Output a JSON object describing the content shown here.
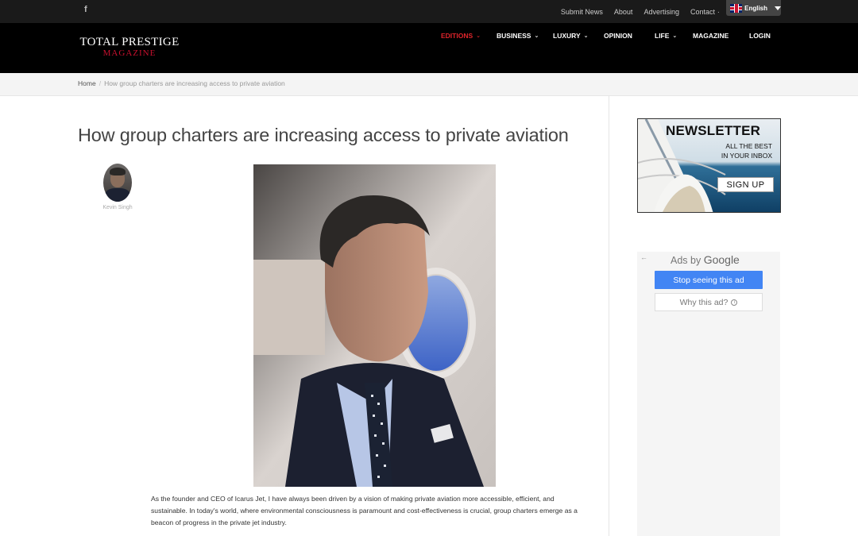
{
  "topbar": {
    "facebook_icon": "f",
    "links": [
      "Submit News",
      "About",
      "Advertising",
      "Contact"
    ],
    "separator": ".",
    "language": "English"
  },
  "header": {
    "logo_line1": "TOTAL PRESTIGE",
    "logo_line2": "MAGAZINE",
    "nav": [
      {
        "label": "EDITIONS",
        "dropdown": true,
        "active": true
      },
      {
        "label": "BUSINESS",
        "dropdown": true,
        "active": false
      },
      {
        "label": "LUXURY",
        "dropdown": true,
        "active": false
      },
      {
        "label": "OPINION",
        "dropdown": false,
        "active": false
      },
      {
        "label": "LIFE",
        "dropdown": true,
        "active": false
      },
      {
        "label": "MAGAZINE",
        "dropdown": false,
        "active": false
      },
      {
        "label": "LOGIN",
        "dropdown": false,
        "active": false
      }
    ],
    "accent_color": "#e0242b"
  },
  "breadcrumb": {
    "home": "Home",
    "separator": "/",
    "current": "How group charters are increasing access to private aviation"
  },
  "article": {
    "title": "How group charters are increasing access to private aviation",
    "author": "Kevin Singh",
    "body": "As the founder and CEO of Icarus Jet, I have always been driven by a vision of making private aviation more accessible, efficient, and sustainable. In today's world, where environmental consciousness is paramount and cost-effectiveness is crucial, group charters emerge as a beacon of progress in the private jet industry."
  },
  "sidebar": {
    "newsletter": {
      "title": "NEWSLETTER",
      "line1": "ALL THE BEST",
      "line2": "IN YOUR INBOX",
      "button": "SIGN UP"
    },
    "ad": {
      "back_icon": "←",
      "ads_by": "Ads by",
      "google": "Google",
      "stop": "Stop seeing this ad",
      "why": "Why this ad?",
      "info_icon": "i"
    }
  }
}
